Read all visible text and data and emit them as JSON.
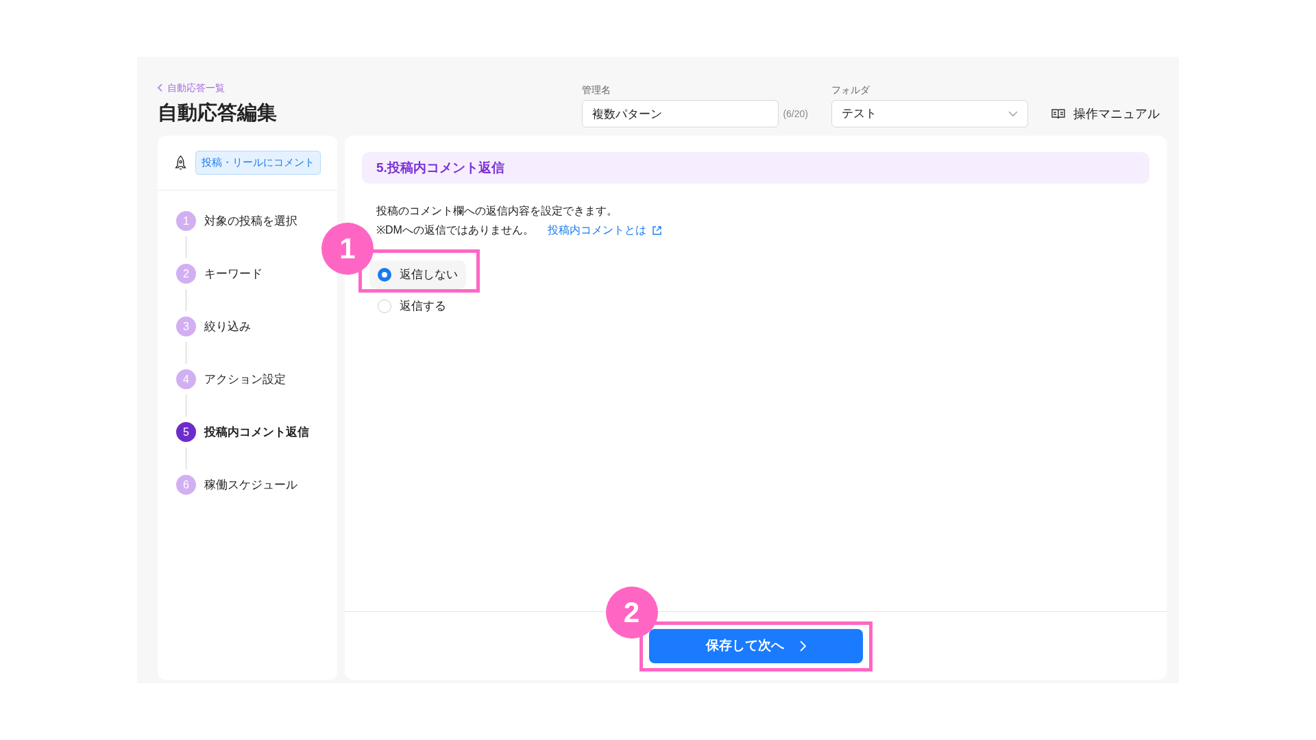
{
  "header": {
    "breadcrumb": "自動応答一覧",
    "title": "自動応答編集"
  },
  "name_field": {
    "label": "管理名",
    "value": "複数パターン",
    "counter": "(6/20)"
  },
  "folder_field": {
    "label": "フォルダ",
    "value": "テスト"
  },
  "manual_link": "操作マニュアル",
  "trigger_badge": "投稿・リールにコメント",
  "steps": [
    {
      "number": "1",
      "label": "対象の投稿を選択",
      "selected": false
    },
    {
      "number": "2",
      "label": "キーワード",
      "selected": false
    },
    {
      "number": "3",
      "label": "絞り込み",
      "selected": false
    },
    {
      "number": "4",
      "label": "アクション設定",
      "selected": false
    },
    {
      "number": "5",
      "label": "投稿内コメント返信",
      "selected": true
    },
    {
      "number": "6",
      "label": "稼働スケジュール",
      "selected": false
    }
  ],
  "section": {
    "title": "5.投稿内コメント返信",
    "description": "投稿のコメント欄への返信内容を設定できます。",
    "note": "※DMへの返信ではありません。",
    "help_link": "投稿内コメントとは"
  },
  "options": [
    {
      "label": "返信しない",
      "selected": true
    },
    {
      "label": "返信する",
      "selected": false
    }
  ],
  "primary_button": "保存して次へ",
  "annotations": [
    {
      "label": "1"
    },
    {
      "label": "2"
    }
  ]
}
